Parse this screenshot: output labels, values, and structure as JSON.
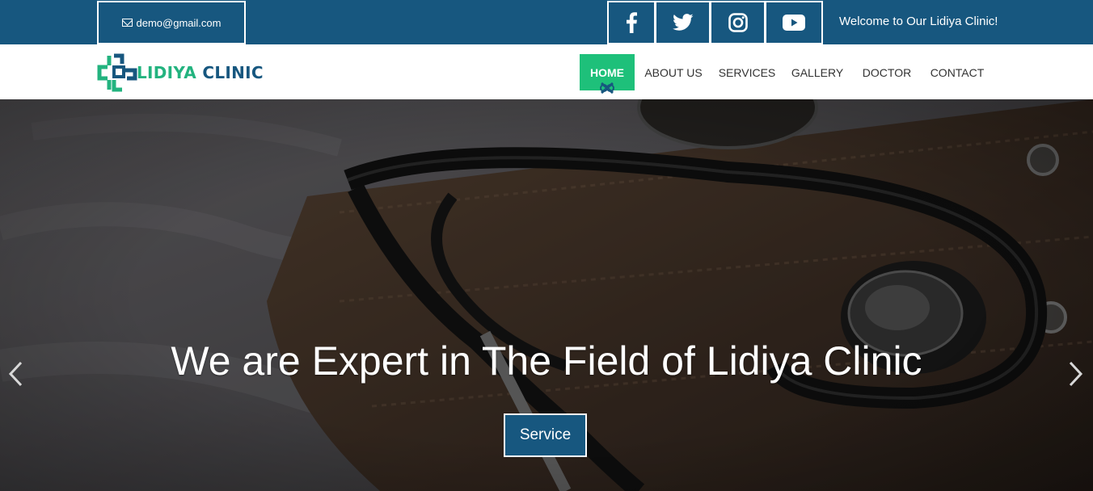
{
  "topbar": {
    "email": "demo@gmail.com",
    "welcome": "Welcome to Our Lidiya Clinic!",
    "social": [
      "facebook-icon",
      "twitter-icon",
      "instagram-icon",
      "youtube-icon"
    ]
  },
  "brand": {
    "name_part1": "LIDIYA",
    "name_part2": "CLINIC"
  },
  "nav": {
    "items": [
      {
        "label": "HOME",
        "active": true
      },
      {
        "label": "ABOUT US",
        "active": false
      },
      {
        "label": "SERVICES",
        "active": false
      },
      {
        "label": "GALLERY",
        "active": false
      },
      {
        "label": "DOCTOR",
        "active": false
      },
      {
        "label": "CONTACT",
        "active": false
      }
    ]
  },
  "hero": {
    "title": "We are Expert in The Field of Lidiya Clinic",
    "button_label": "Service"
  },
  "colors": {
    "primary": "#17577f",
    "accent": "#1ec07a"
  }
}
